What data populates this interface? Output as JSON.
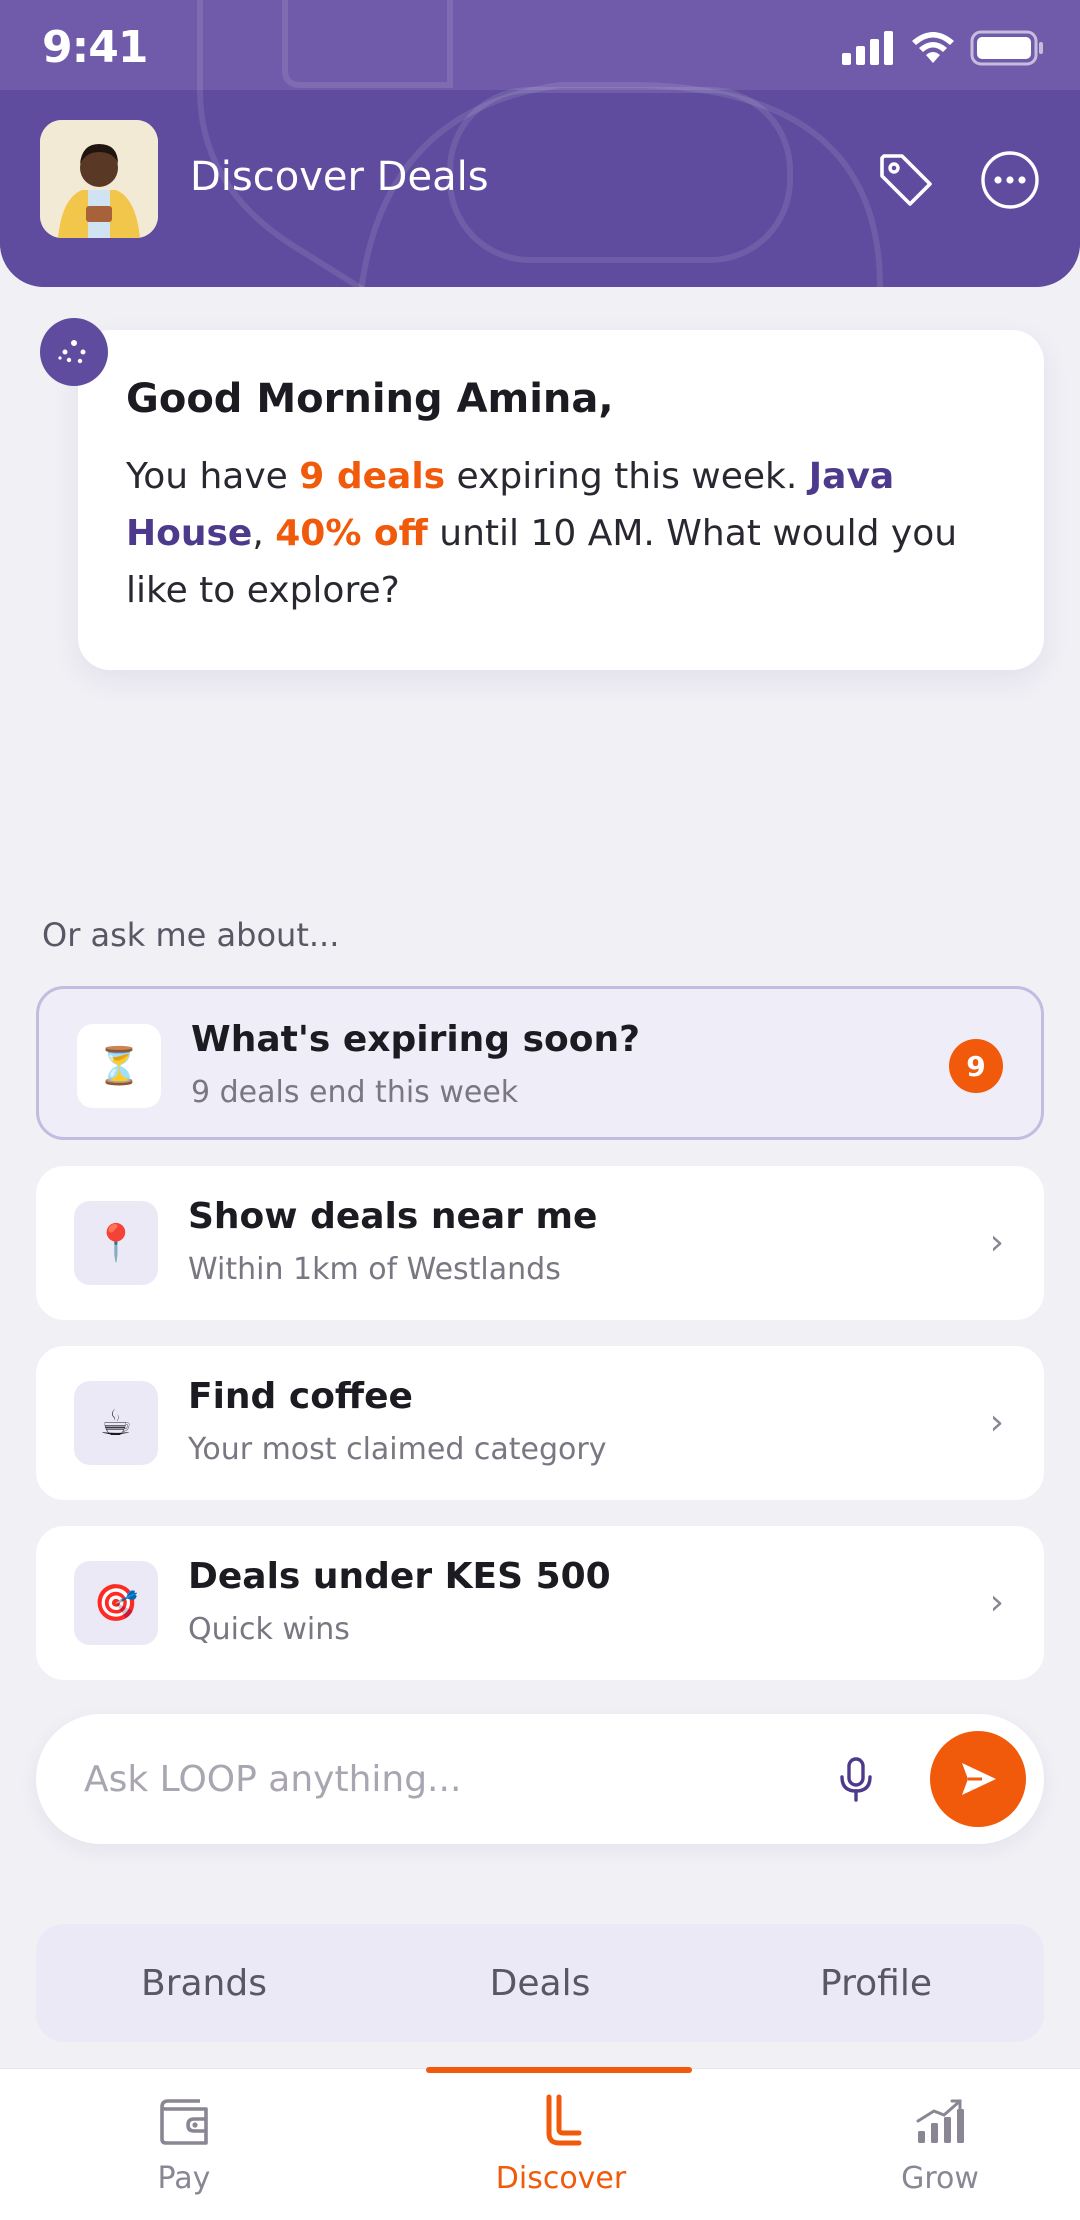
{
  "status_bar": {
    "time": "9:41"
  },
  "header": {
    "title": "Discover Deals",
    "tag_icon": "tag-icon",
    "more_icon": "more-horizontal-icon",
    "brand_color": "#5f4c9e"
  },
  "greeting": {
    "title": "Good Morning Amina,",
    "msg_part1": "You have ",
    "deals_highlight": "9 deals",
    "msg_part2": " expiring this week. ",
    "brand_highlight": "Java House",
    "msg_part3": ", ",
    "discount_highlight": "40% off",
    "msg_part4": " until 10 AM. What would you like to explore?"
  },
  "ask_label": "Or ask me about...",
  "suggestions": [
    {
      "icon": "hourglass-icon",
      "glyph": "⏳",
      "title": "What's expiring soon?",
      "subtitle": "9 deals end this week",
      "count": "9",
      "active": true
    },
    {
      "icon": "location-pin-icon",
      "glyph": "📍",
      "title": "Show deals near me",
      "subtitle": "Within 1km of Westlands",
      "chevron": "›"
    },
    {
      "icon": "coffee-icon",
      "glyph": "☕",
      "title": "Find coffee",
      "subtitle": "Your most claimed category",
      "chevron": "›"
    },
    {
      "icon": "target-icon",
      "glyph": "🎯",
      "title": "Deals under KES 500",
      "subtitle": "Quick wins",
      "chevron": "›"
    }
  ],
  "ask_bar": {
    "placeholder": "Ask LOOP anything..."
  },
  "sub_tabs": [
    "Brands",
    "Deals",
    "Profile"
  ],
  "bottom_nav": [
    {
      "label": "Pay",
      "icon": "wallet-icon"
    },
    {
      "label": "Discover",
      "icon": "discover-l-icon",
      "active": true
    },
    {
      "label": "Grow",
      "icon": "growth-chart-icon"
    }
  ],
  "colors": {
    "accent": "#f05a0a",
    "primary": "#5f4c9e",
    "background": "#f1f0f5"
  }
}
